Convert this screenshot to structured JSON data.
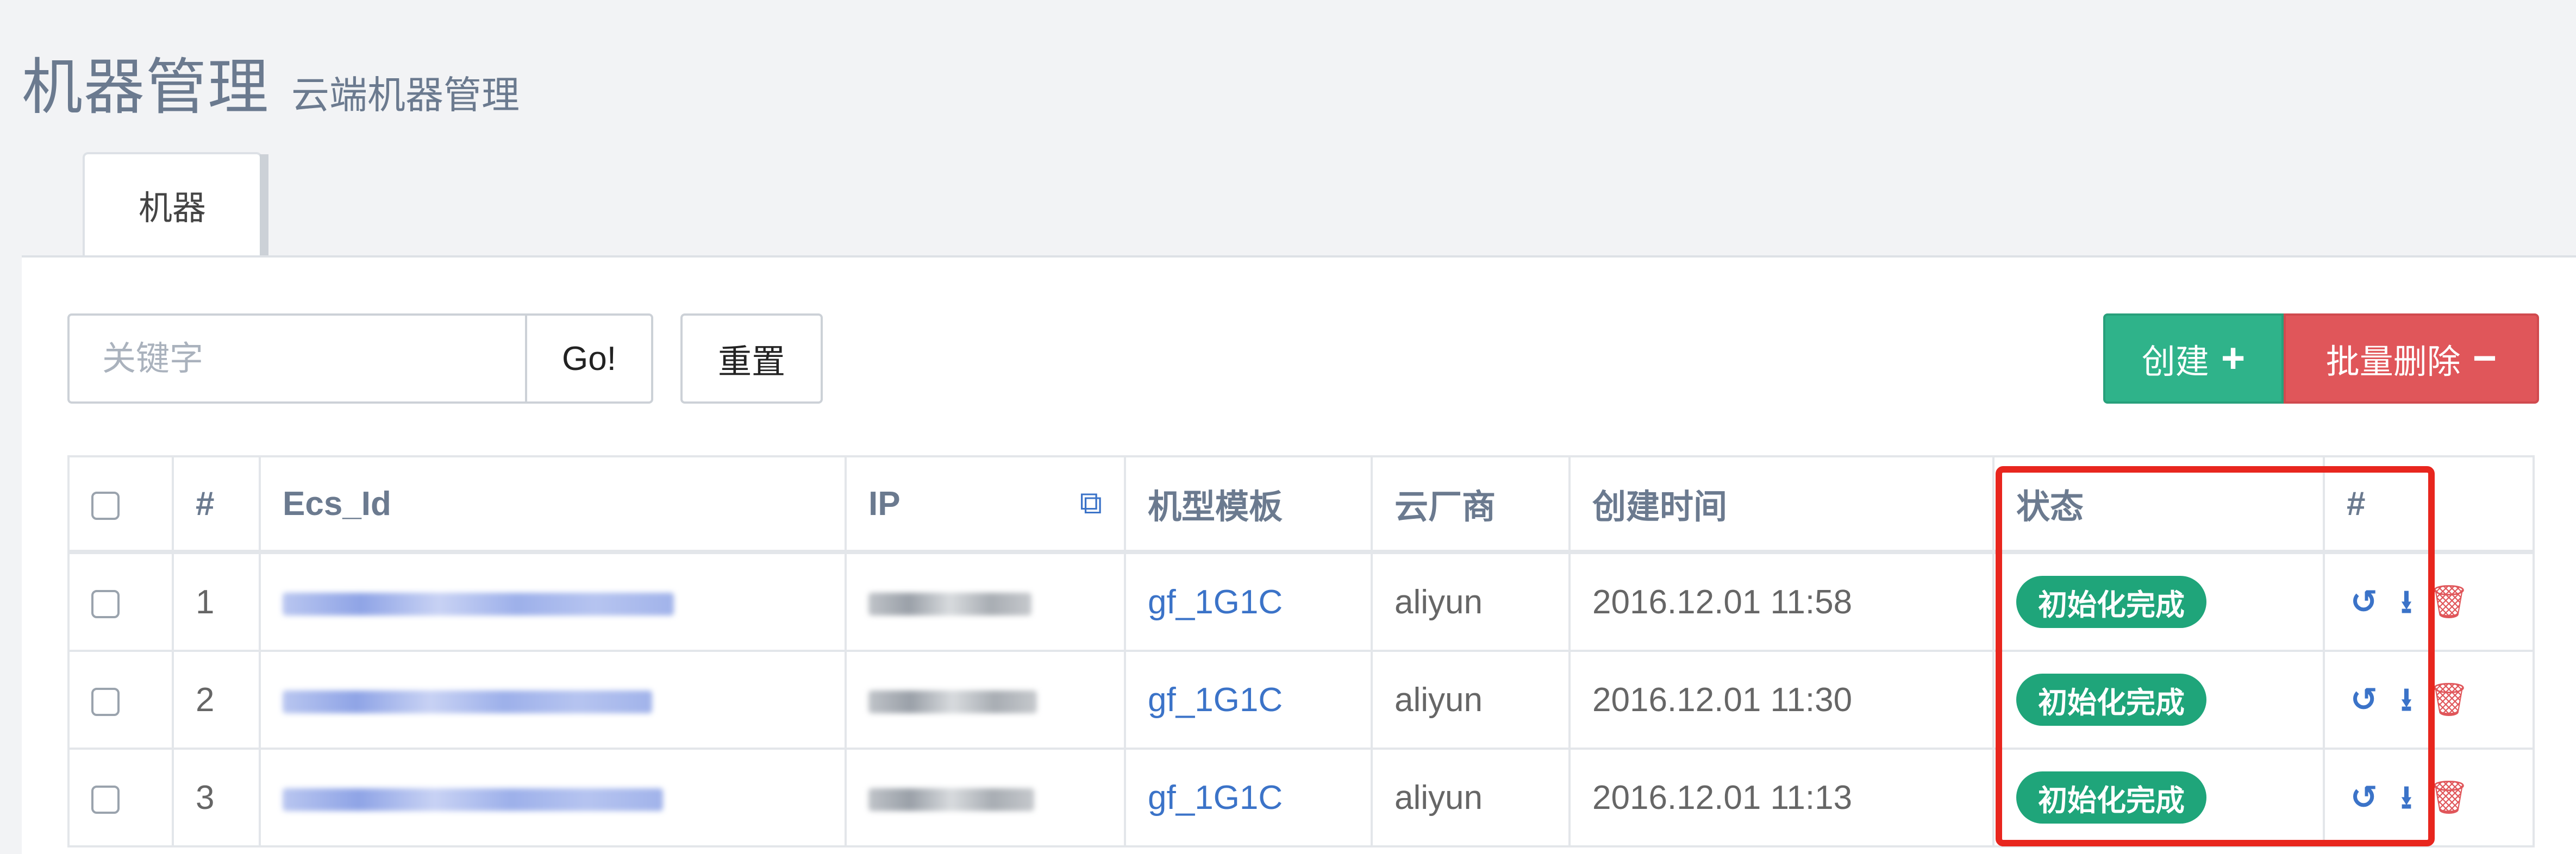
{
  "header": {
    "title": "机器管理",
    "subtitle": "云端机器管理"
  },
  "tabs": [
    {
      "label": "机器",
      "active": true
    }
  ],
  "toolbar": {
    "search_placeholder": "关键字",
    "go_label": "Go!",
    "reset_label": "重置",
    "create_label": "创建",
    "create_icon": "plus-icon",
    "batch_delete_label": "批量删除",
    "batch_delete_icon": "minus-icon"
  },
  "table": {
    "columns": [
      "",
      "#",
      "Ecs_Id",
      "IP",
      "机型模板",
      "云厂商",
      "创建时间",
      "状态",
      "#"
    ],
    "rows": [
      {
        "index": "1",
        "ecs_id": "[redacted]",
        "ip": "[redacted]",
        "template": "gf_1G1C",
        "vendor": "aliyun",
        "created": "2016.12.01 11:58",
        "status": "初始化完成"
      },
      {
        "index": "2",
        "ecs_id": "[redacted]",
        "ip": "[redacted]",
        "template": "gf_1G1C",
        "vendor": "aliyun",
        "created": "2016.12.01 11:30",
        "status": "初始化完成"
      },
      {
        "index": "3",
        "ecs_id": "[redacted]",
        "ip": "[redacted]",
        "template": "gf_1G1C",
        "vendor": "aliyun",
        "created": "2016.12.01 11:13",
        "status": "初始化完成"
      }
    ],
    "row_actions": [
      "history-icon",
      "download-icon",
      "trash-icon"
    ]
  },
  "colors": {
    "create": "#2fb38a",
    "delete": "#e0565a",
    "status_badge": "#1fa57a",
    "link": "#3b73c8",
    "annotation": "#e8261e"
  }
}
